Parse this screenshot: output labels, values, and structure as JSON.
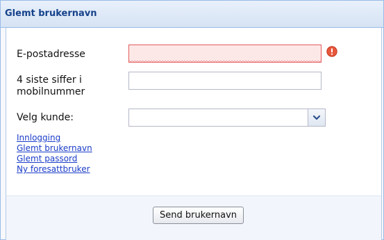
{
  "panel": {
    "title": "Glemt brukernavn"
  },
  "form": {
    "email_label": "E-postadresse",
    "email_value": "",
    "phone_label_line1": "4 siste siffer i",
    "phone_label_line2": "mobilnummer",
    "phone_value": "",
    "customer_label": "Velg kunde:",
    "customer_selected": ""
  },
  "links": {
    "login": "Innlogging",
    "forgot_username": "Glemt brukernavn",
    "forgot_password": "Glemt passord",
    "new_parent_user": "Ny foresattbruker"
  },
  "actions": {
    "send_label": "Send brukernavn"
  },
  "icons": {
    "error": "error-icon",
    "dropdown": "chevron-down-icon"
  },
  "colors": {
    "header_text": "#15428b",
    "link": "#1a3cc8",
    "error": "#e35a5a"
  }
}
